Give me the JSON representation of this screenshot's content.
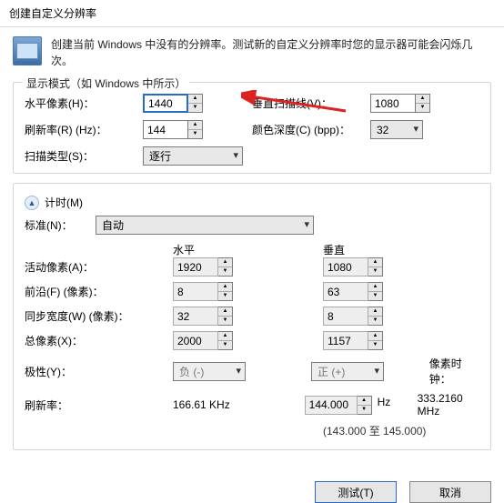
{
  "title": "创建自定义分辨率",
  "intro": "创建当前 Windows 中没有的分辨率。测试新的自定义分辨率时您的显示器可能会闪烁几次。",
  "display_mode": {
    "legend": "显示模式（如 Windows 中所示）",
    "hpixels_label": "水平像素(H)：",
    "hpixels_value": "1440",
    "vscanlines_label": "垂直扫描线(V)：",
    "vscanlines_value": "1080",
    "refresh_label": "刷新率(R) (Hz)：",
    "refresh_value": "144",
    "colordepth_label": "颜色深度(C) (bpp)：",
    "colordepth_value": "32",
    "scantype_label": "扫描类型(S)：",
    "scantype_value": "逐行"
  },
  "timing": {
    "toggle": "▲",
    "header": "计时(M)",
    "standard_label": "标准(N)：",
    "standard_value": "自动",
    "col_h": "水平",
    "col_v": "垂直",
    "active_label": "活动像素(A)：",
    "active_h": "1920",
    "active_v": "1080",
    "frontporch_label": "前沿(F) (像素)：",
    "frontporch_h": "8",
    "frontporch_v": "63",
    "syncwidth_label": "同步宽度(W) (像素)：",
    "syncwidth_h": "32",
    "syncwidth_v": "8",
    "total_label": "总像素(X)：",
    "total_h": "2000",
    "total_v": "1157",
    "polarity_label": "极性(Y)：",
    "polarity_h": "负 (-)",
    "polarity_v": "正 (+)",
    "pixelclock_label": "像素时钟：",
    "pixelclock_value": "333.2160 MHz",
    "refresh2_label": "刷新率：",
    "refresh2_h": "166.61 KHz",
    "refresh2_v": "144.000",
    "refresh2_unit": "Hz",
    "range_note": "(143.000 至 145.000)"
  },
  "buttons": {
    "test": "测试(T)",
    "cancel": "取消"
  }
}
